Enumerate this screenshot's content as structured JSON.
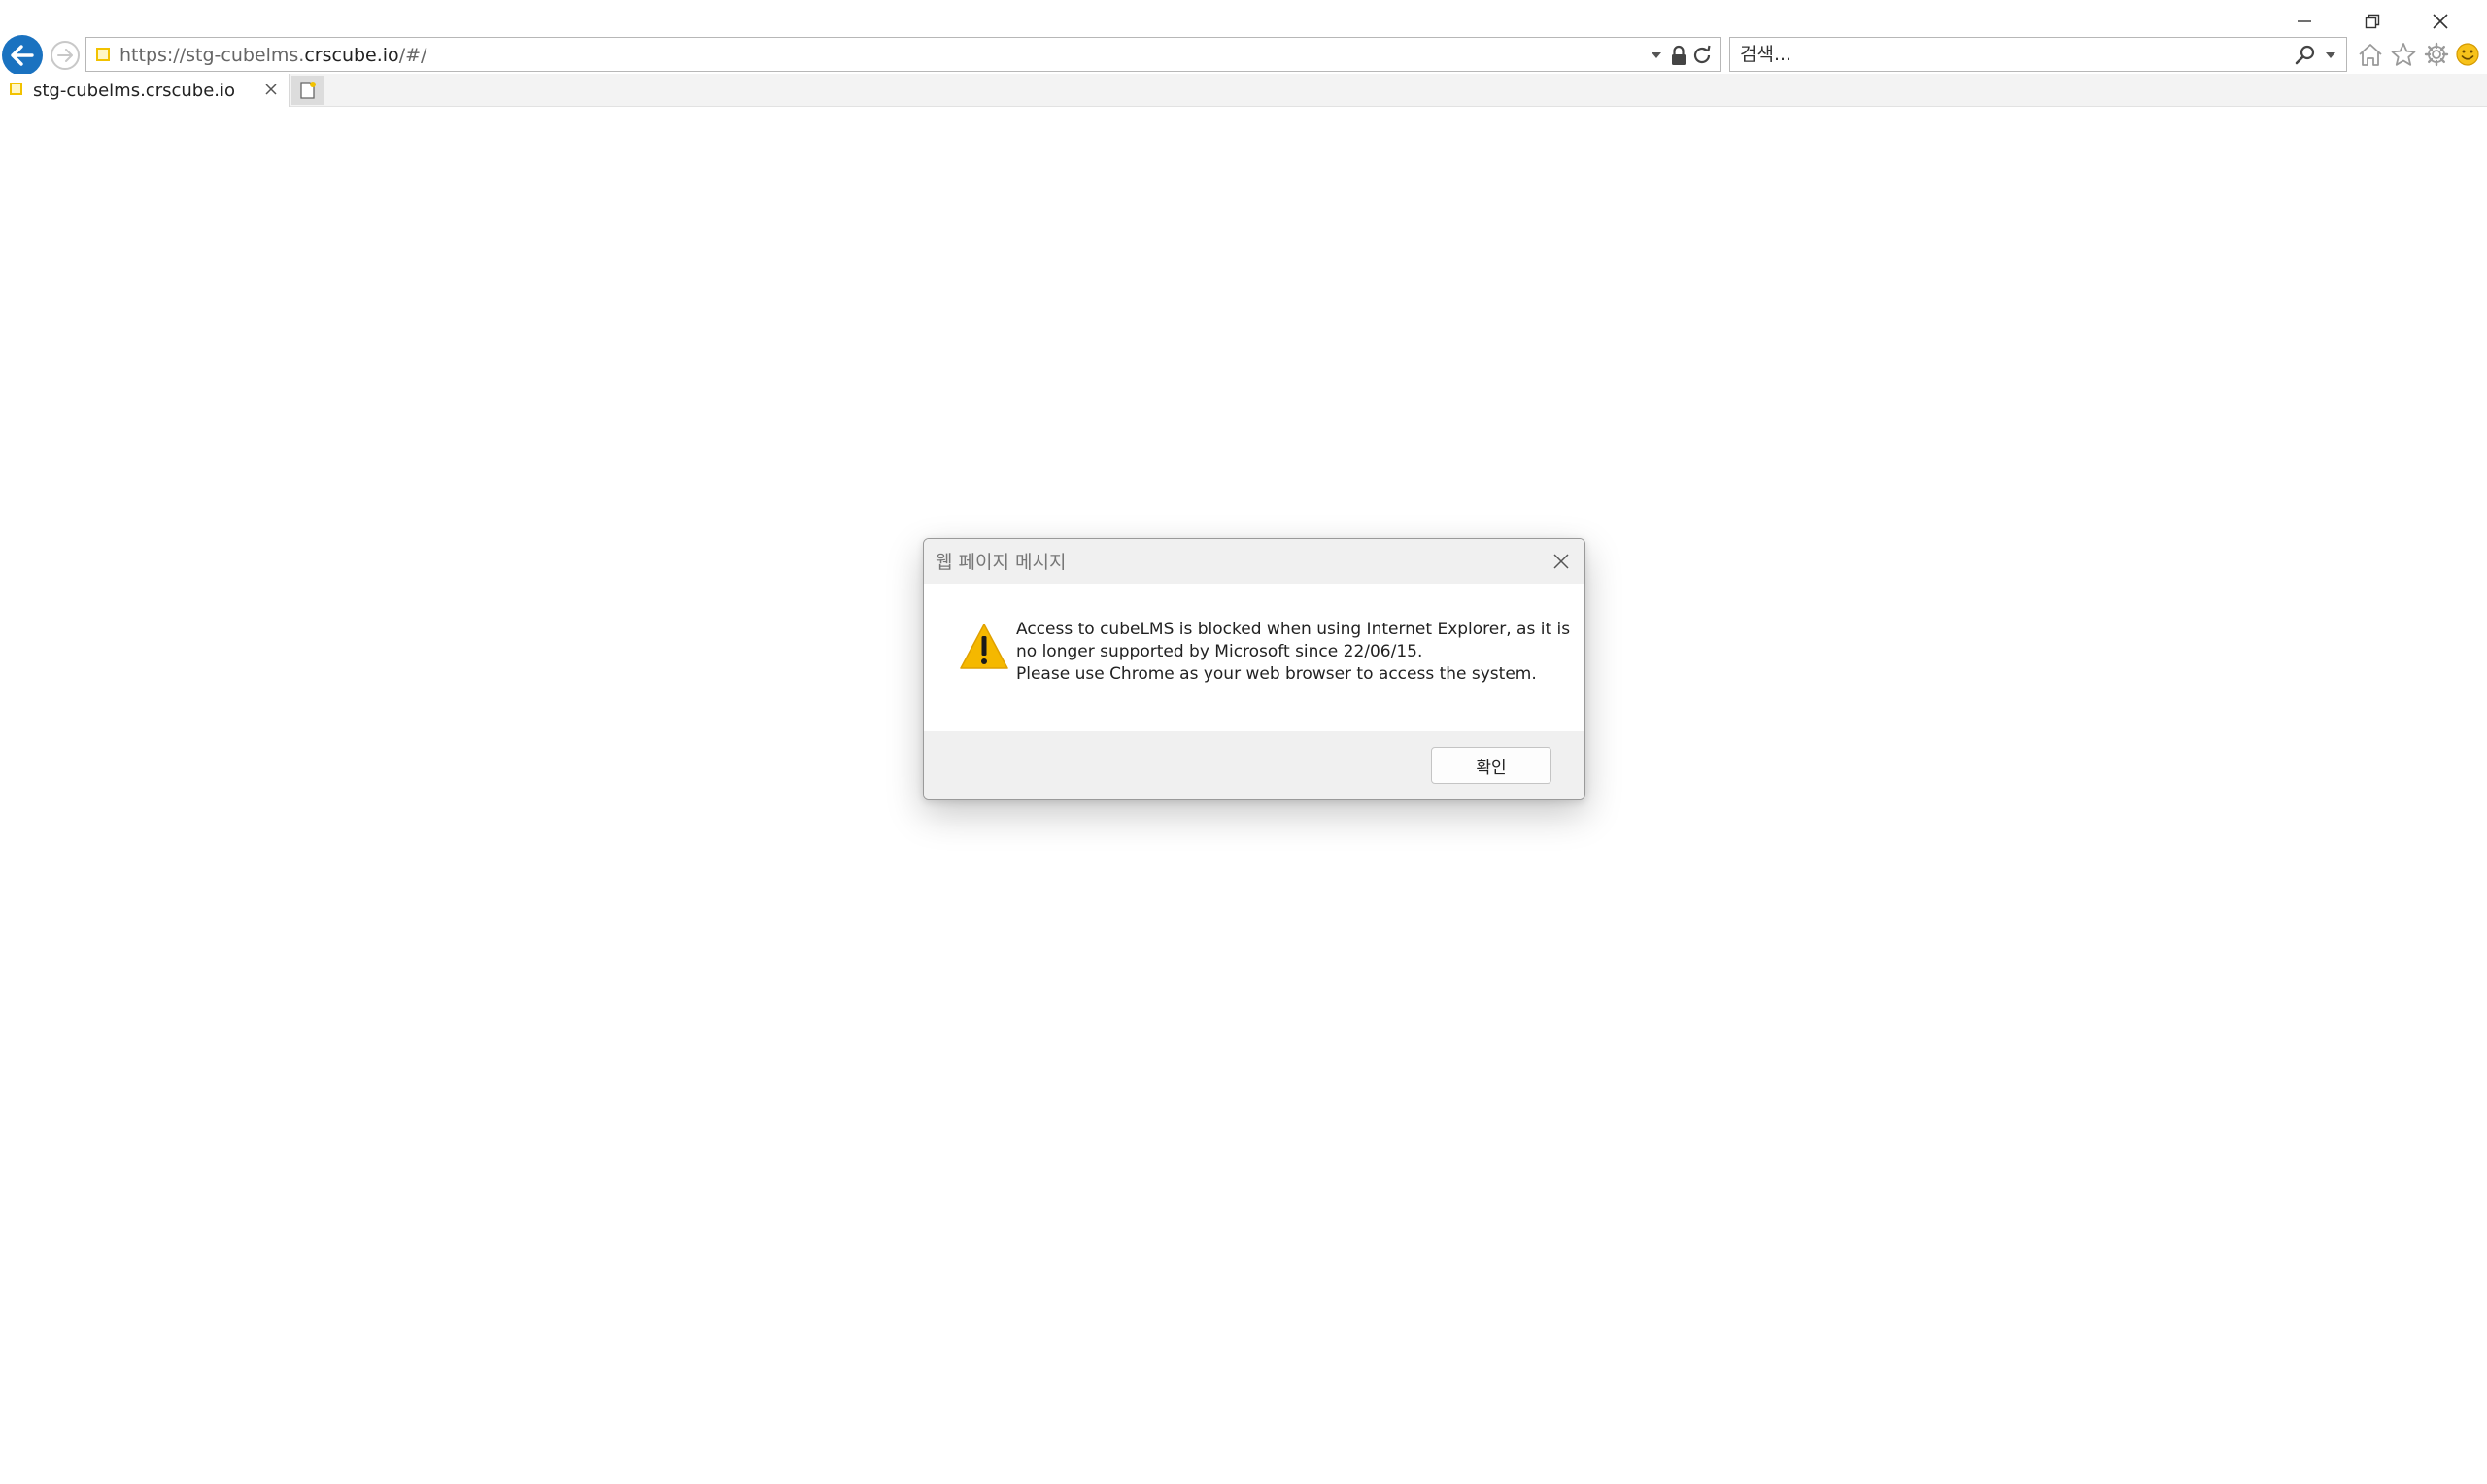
{
  "address_bar": {
    "url_prefix": "https://stg-cubelms.",
    "url_domain": "crscube.io",
    "url_suffix": "/#/"
  },
  "search": {
    "placeholder": "검색..."
  },
  "tab": {
    "title": "stg-cubelms.crscube.io"
  },
  "dialog": {
    "title": "웹 페이지 메시지",
    "message_lines": [
      "Access to cubeLMS is blocked when using Internet Explorer, as it is",
      "no longer supported by Microsoft since 22/06/15.",
      "Please use Chrome as your web browser to access the system."
    ],
    "ok_label": "확인"
  },
  "colors": {
    "back_button": "#1a72c0",
    "warning": "#f5b800",
    "site_icon": "#f2c200"
  }
}
